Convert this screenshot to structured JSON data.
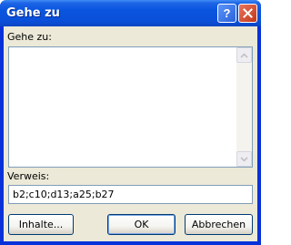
{
  "window": {
    "title": "Gehe zu"
  },
  "goto_list": {
    "label": "Gehe zu:"
  },
  "reference": {
    "label": "Verweis:",
    "value": "b2;c10;d13;a25;b27"
  },
  "buttons": {
    "contents": "Inhalte...",
    "ok": "OK",
    "cancel": "Abbrechen"
  },
  "titlebar_buttons": {
    "help": "?",
    "help_icon": "question-mark",
    "close_icon": "x-cross"
  },
  "colors": {
    "titlebar": "#0a55df",
    "dialog_bg": "#ece9d8",
    "input_border": "#7f9db9"
  }
}
